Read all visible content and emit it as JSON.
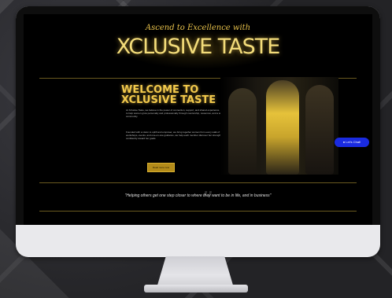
{
  "site": {
    "tagline": "Ascend to Excellence with",
    "brand": "XCLUSIVE TASTE",
    "welcome_line1": "WELCOME TO",
    "welcome_line2": "XCLUSIVE TASTE",
    "paragraph1": "At Xclusive Taste, we believe in the power of connection, support, and shared experience. Our mission is to help women grow personally and professionally through mentorship, resources, and a welcoming community.",
    "paragraph2": "Founded with a vision to uplift and empower, we bring together women from every walk of life. Through workshops, events, and one-on-one guidance, we help each member discover her strengths and step confidently toward her goals.",
    "cta_label": "Read more now",
    "chat_label": "Let's Chat!",
    "quote": "\"Helping others get one step closer to where they want to be in life, and in business\""
  },
  "colors": {
    "gold": "#f2c94c",
    "chat_blue": "#1a2be0",
    "page_bg": "#000000"
  }
}
